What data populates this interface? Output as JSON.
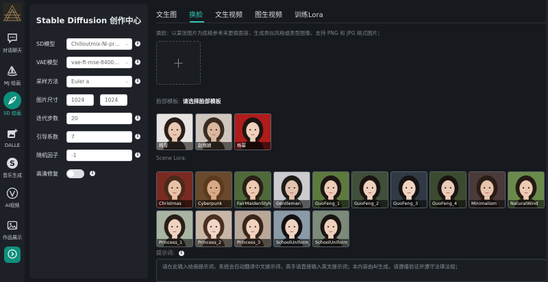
{
  "nav": {
    "items": [
      {
        "label": "对话聊天",
        "icon": "chat-icon"
      },
      {
        "label": "MJ 绘画",
        "icon": "sailboat-icon"
      },
      {
        "label": "SD 绘画",
        "icon": "compass-icon",
        "active": true
      },
      {
        "label": "DALLE",
        "icon": "image-plus-icon"
      },
      {
        "label": "音乐生成",
        "icon": "music-s-icon"
      },
      {
        "label": "AI视频",
        "icon": "video-v-icon"
      },
      {
        "label": "作品展示",
        "icon": "gallery-icon"
      }
    ],
    "expand_icon": "chevron-right-icon"
  },
  "panel": {
    "title": "Stable Diffusion 创作中心",
    "sd_model_label": "SD模型",
    "sd_model_value": "Chilloutmix-Ni-pru...",
    "vae_label": "VAE模型",
    "vae_value": "vae-ft-mse-840000...",
    "sampler_label": "采样方法",
    "sampler_value": "Euler a",
    "size_label": "图片尺寸",
    "width_value": "1024",
    "height_value": "1024",
    "steps_label": "迭代步数",
    "steps_value": "20",
    "cfg_label": "引导系数",
    "cfg_value": "7",
    "seed_label": "随机因子",
    "seed_value": "-1",
    "hires_label": "高清修复"
  },
  "main": {
    "tabs": [
      {
        "label": "文生图"
      },
      {
        "label": "换脸",
        "active": true
      },
      {
        "label": "文生视频"
      },
      {
        "label": "图生视频"
      },
      {
        "label": "训练Lora"
      }
    ],
    "swap_hint": "换脸：以某张图片为底稿参考来更换面容，生成类似风格或类型图像，支持 PNG 和 JPG 格式图片；",
    "face_template_label": "脸部模板:",
    "face_template_action": "请选择脸部模板",
    "faces": [
      {
        "name": "韩雪"
      },
      {
        "name": "赵丽颖"
      },
      {
        "name": "杨幂"
      }
    ],
    "scene_lora_label": "Scene Lora:",
    "loras": [
      {
        "name": "Christmas"
      },
      {
        "name": "Cyberpunk"
      },
      {
        "name": "FairMaidenStyle"
      },
      {
        "name": "Gentleman"
      },
      {
        "name": "GuoFeng_1"
      },
      {
        "name": "GuoFeng_2"
      },
      {
        "name": "GuoFeng_3"
      },
      {
        "name": "GuoFeng_4"
      },
      {
        "name": "Minimalism"
      },
      {
        "name": "NaturalWind"
      },
      {
        "name": "Princess_1"
      },
      {
        "name": "Princess_2"
      },
      {
        "name": "Princess_3"
      },
      {
        "name": "SchoolUniform_1"
      },
      {
        "name": "SchoolUniform_2"
      }
    ],
    "prompt_label": "提示词:",
    "prompt_placeholder": "请在此输入绘画提示词，系统会自动翻译中文提示词，高手请直接输入英文提示词；本内容由AI生成，请遵循验证并遵守法律法规；"
  },
  "colors": {
    "accent": "#2fc4ad",
    "active_nav": "#0f8f7d",
    "background": "#16191e",
    "panel": "#1f2329"
  }
}
